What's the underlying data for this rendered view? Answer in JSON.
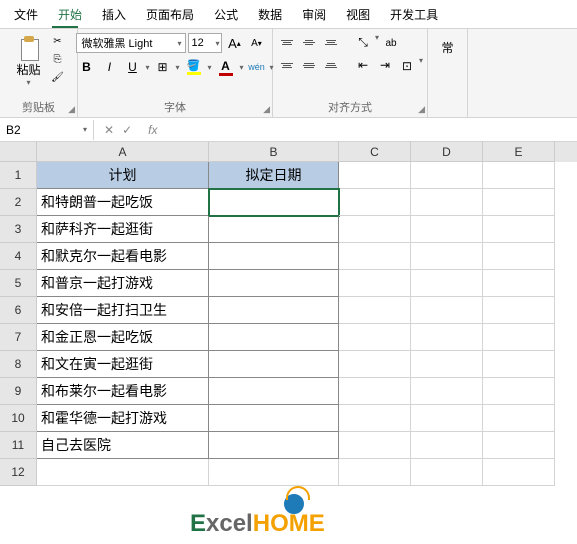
{
  "tabs": [
    "文件",
    "开始",
    "插入",
    "页面布局",
    "公式",
    "数据",
    "审阅",
    "视图",
    "开发工具"
  ],
  "activeTab": 1,
  "clipboard": {
    "paste": "粘贴",
    "groupLabel": "剪贴板"
  },
  "font": {
    "name": "微软雅黑 Light",
    "size": "12",
    "bold": "B",
    "italic": "I",
    "underline": "U",
    "wenLabel": "wén",
    "groupLabel": "字体",
    "aInc": "A",
    "aDec": "A"
  },
  "align": {
    "groupLabel": "对齐方式",
    "abLabel": "ab"
  },
  "extra": {
    "label": "常"
  },
  "nameBox": "B2",
  "formulaBar": "",
  "columns": [
    "A",
    "B",
    "C",
    "D",
    "E"
  ],
  "headers": {
    "a": "计划",
    "b": "拟定日期"
  },
  "rows": [
    {
      "n": "1"
    },
    {
      "n": "2",
      "a": "和特朗普一起吃饭"
    },
    {
      "n": "3",
      "a": "和萨科齐一起逛街"
    },
    {
      "n": "4",
      "a": "和默克尔一起看电影"
    },
    {
      "n": "5",
      "a": "和普京一起打游戏"
    },
    {
      "n": "6",
      "a": "和安倍一起打扫卫生"
    },
    {
      "n": "7",
      "a": "和金正恩一起吃饭"
    },
    {
      "n": "8",
      "a": "和文在寅一起逛街"
    },
    {
      "n": "9",
      "a": "和布莱尔一起看电影"
    },
    {
      "n": "10",
      "a": "和霍华德一起打游戏"
    },
    {
      "n": "11",
      "a": "自己去医院"
    },
    {
      "n": "12"
    }
  ],
  "watermark": {
    "e": "E",
    "xcel": "xcel",
    "home": "HOME"
  }
}
